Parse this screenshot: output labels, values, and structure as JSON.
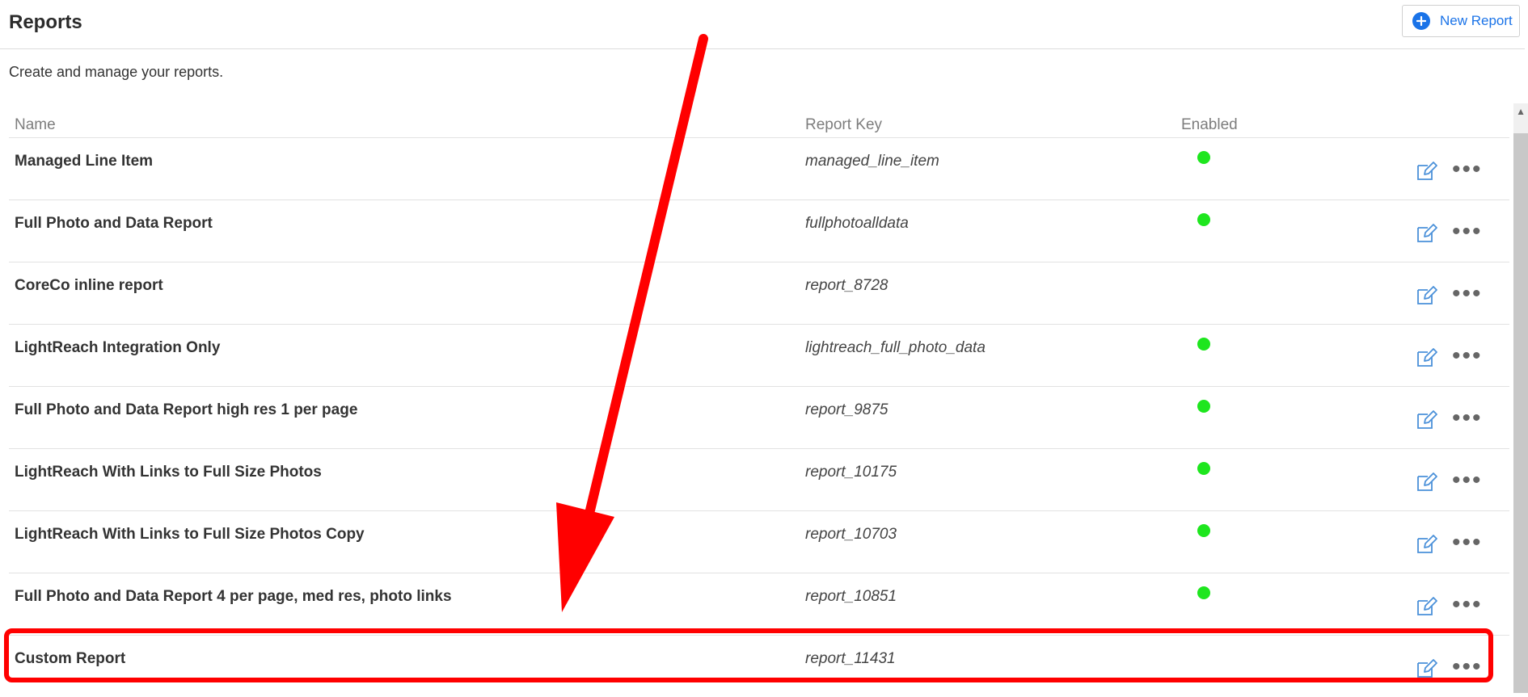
{
  "header": {
    "title": "Reports",
    "new_report_label": "New Report"
  },
  "subtitle": "Create and manage your reports.",
  "table": {
    "columns": {
      "name": "Name",
      "key": "Report Key",
      "enabled": "Enabled"
    },
    "rows": [
      {
        "name": "Managed Line Item",
        "key": "managed_line_item",
        "enabled": true
      },
      {
        "name": "Full Photo and Data Report",
        "key": "fullphotoalldata",
        "enabled": true
      },
      {
        "name": "CoreCo inline report",
        "key": "report_8728",
        "enabled": false
      },
      {
        "name": "LightReach Integration Only",
        "key": "lightreach_full_photo_data",
        "enabled": true
      },
      {
        "name": "Full Photo and Data Report high res 1 per page",
        "key": "report_9875",
        "enabled": true
      },
      {
        "name": "LightReach With Links to Full Size Photos",
        "key": "report_10175",
        "enabled": true
      },
      {
        "name": "LightReach With Links to Full Size Photos Copy",
        "key": "report_10703",
        "enabled": true
      },
      {
        "name": "Full Photo and Data Report 4 per page, med res, photo links",
        "key": "report_10851",
        "enabled": true
      },
      {
        "name": "Custom Report",
        "key": "report_11431",
        "enabled": false
      }
    ]
  },
  "icons": {
    "new_report": "plus-circle-icon",
    "edit": "edit-icon",
    "more": "more-options-icon"
  },
  "colors": {
    "accent": "#1a73e8",
    "enabled": "#1ee61e",
    "highlight": "#ff0000"
  }
}
